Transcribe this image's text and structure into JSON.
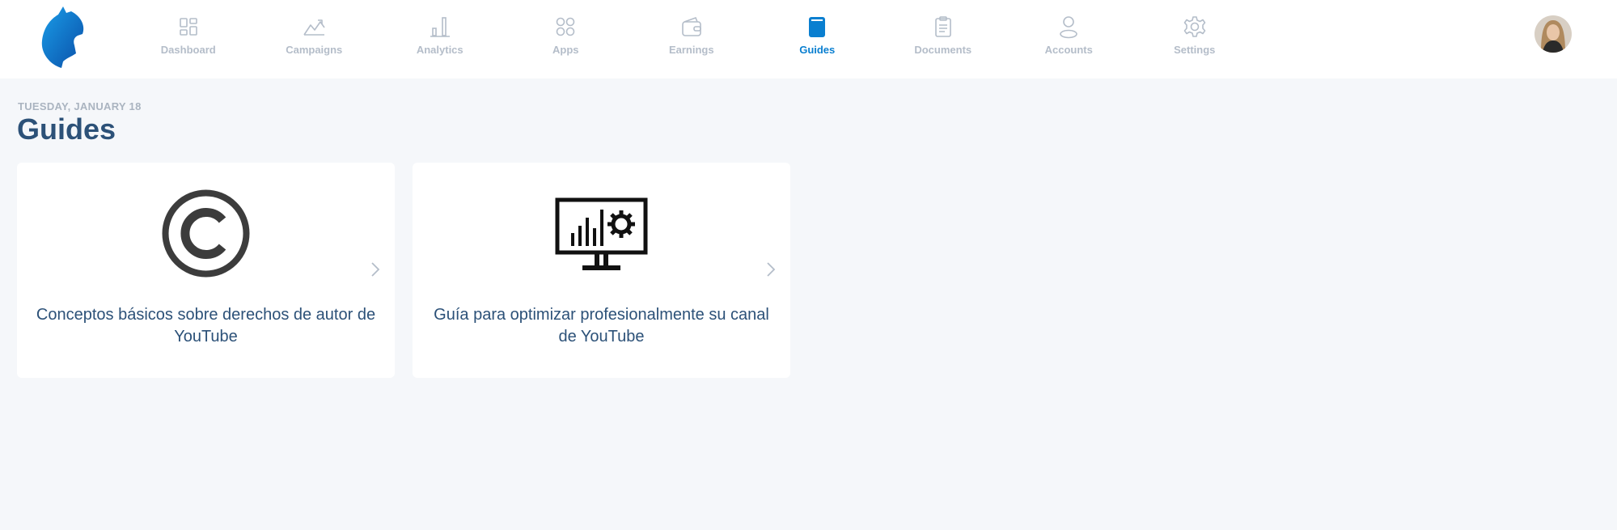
{
  "nav": {
    "items": [
      {
        "label": "Dashboard",
        "icon": "dashboard-icon",
        "active": false
      },
      {
        "label": "Campaigns",
        "icon": "campaigns-icon",
        "active": false
      },
      {
        "label": "Analytics",
        "icon": "analytics-icon",
        "active": false
      },
      {
        "label": "Apps",
        "icon": "apps-icon",
        "active": false
      },
      {
        "label": "Earnings",
        "icon": "wallet-icon",
        "active": false
      },
      {
        "label": "Guides",
        "icon": "book-icon",
        "active": true
      },
      {
        "label": "Documents",
        "icon": "clipboard-icon",
        "active": false
      },
      {
        "label": "Accounts",
        "icon": "user-icon",
        "active": false
      },
      {
        "label": "Settings",
        "icon": "gear-icon",
        "active": false
      }
    ]
  },
  "header": {
    "date": "TUESDAY, JANUARY 18",
    "title": "Guides"
  },
  "cards": [
    {
      "text": "Conceptos básicos sobre derechos de autor de YouTube",
      "icon": "copyright-icon"
    },
    {
      "text": "Guía para optimizar profesionalmente su canal de YouTube",
      "icon": "monitor-analytics-icon"
    }
  ],
  "colors": {
    "accent": "#0a7fd0",
    "nav_inactive": "#b4bdc9",
    "title": "#2c5178",
    "background": "#f5f7fa",
    "card": "#ffffff"
  }
}
